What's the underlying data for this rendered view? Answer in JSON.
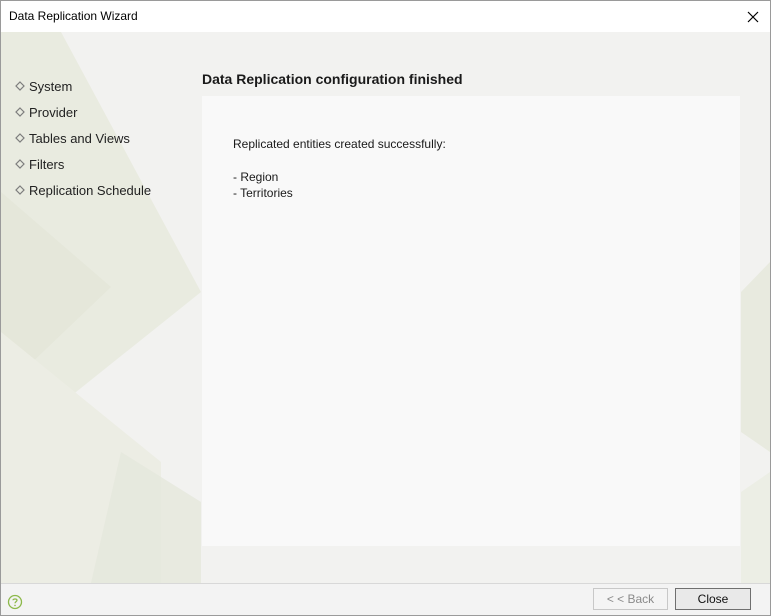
{
  "window": {
    "title": "Data Replication Wizard"
  },
  "sidebar": {
    "items": [
      {
        "label": "System"
      },
      {
        "label": "Provider"
      },
      {
        "label": "Tables and Views"
      },
      {
        "label": "Filters"
      },
      {
        "label": "Replication Schedule"
      }
    ]
  },
  "main": {
    "title": "Data Replication configuration finished",
    "message": "Replicated entities created successfully:",
    "entities": [
      "- Region",
      "- Territories"
    ]
  },
  "footer": {
    "back_label": "< < Back",
    "close_label": "Close",
    "help_icon": "help-icon"
  },
  "colors": {
    "help_icon": "#8cb84a",
    "content_bg": "#f2f2f0",
    "panel_bg": "#f9f9f9",
    "decor_shape": "#e9ebe0"
  }
}
